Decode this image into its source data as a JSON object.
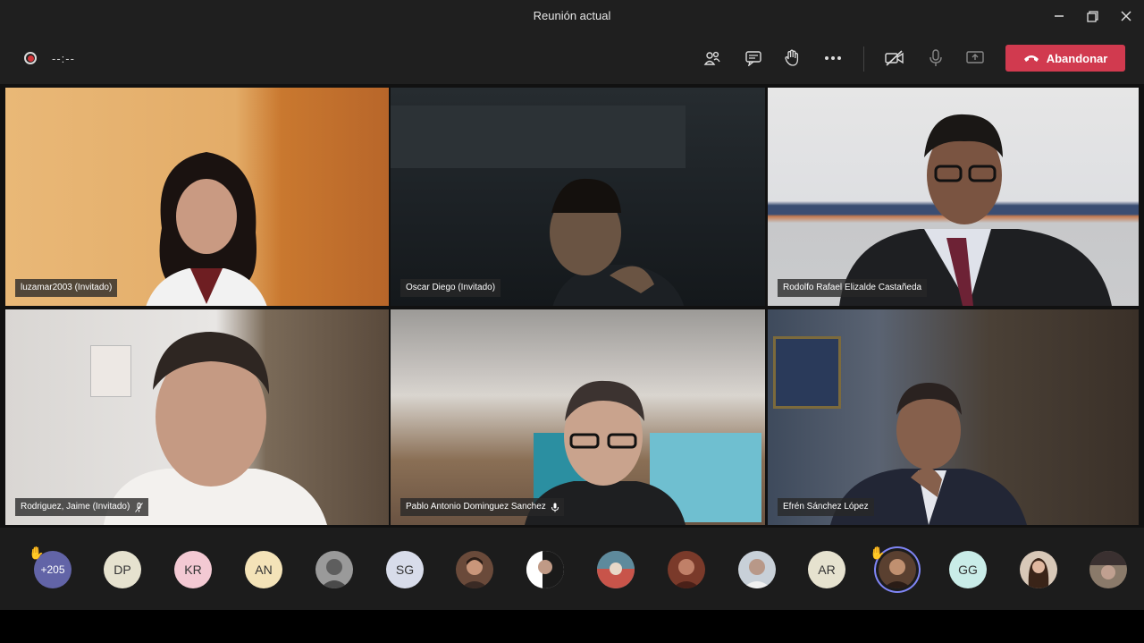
{
  "window": {
    "title": "Reunión actual"
  },
  "toolbar": {
    "timer": "--:--",
    "leave_label": "Abandonar"
  },
  "tiles": [
    {
      "name": "luzamar2003 (Invitado)"
    },
    {
      "name": "Oscar Diego (Invitado)"
    },
    {
      "name": "Rodolfo Rafael Elizalde Castañeda"
    },
    {
      "name": "Rodriguez, Jaime (Invitado)"
    },
    {
      "name": "Pablo Antonio Dominguez Sanchez"
    },
    {
      "name": "Efrén Sánchez López"
    }
  ],
  "roster": {
    "overflow_count": "+205",
    "initials": [
      "DP",
      "KR",
      "AN",
      "SG",
      "AR",
      "GG"
    ]
  },
  "colors": {
    "accent_leave": "#d13a4f",
    "overflow_badge": "#6264a7",
    "speaking_ring": "#7f85f5"
  }
}
